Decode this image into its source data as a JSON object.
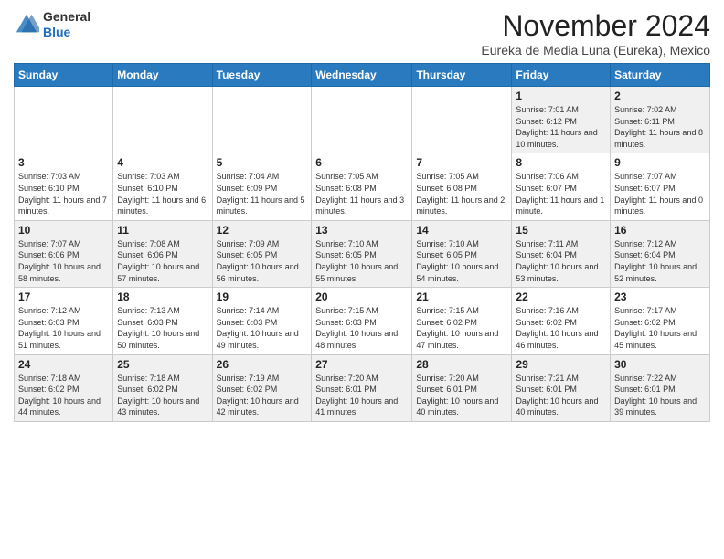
{
  "header": {
    "logo_line1": "General",
    "logo_line2": "Blue",
    "month": "November 2024",
    "location": "Eureka de Media Luna (Eureka), Mexico"
  },
  "days_of_week": [
    "Sunday",
    "Monday",
    "Tuesday",
    "Wednesday",
    "Thursday",
    "Friday",
    "Saturday"
  ],
  "weeks": [
    [
      {
        "day": "",
        "info": "",
        "empty": true
      },
      {
        "day": "",
        "info": "",
        "empty": true
      },
      {
        "day": "",
        "info": "",
        "empty": true
      },
      {
        "day": "",
        "info": "",
        "empty": true
      },
      {
        "day": "",
        "info": "",
        "empty": true
      },
      {
        "day": "1",
        "info": "Sunrise: 7:01 AM\nSunset: 6:12 PM\nDaylight: 11 hours and 10 minutes."
      },
      {
        "day": "2",
        "info": "Sunrise: 7:02 AM\nSunset: 6:11 PM\nDaylight: 11 hours and 8 minutes."
      }
    ],
    [
      {
        "day": "3",
        "info": "Sunrise: 7:03 AM\nSunset: 6:10 PM\nDaylight: 11 hours and 7 minutes."
      },
      {
        "day": "4",
        "info": "Sunrise: 7:03 AM\nSunset: 6:10 PM\nDaylight: 11 hours and 6 minutes."
      },
      {
        "day": "5",
        "info": "Sunrise: 7:04 AM\nSunset: 6:09 PM\nDaylight: 11 hours and 5 minutes."
      },
      {
        "day": "6",
        "info": "Sunrise: 7:05 AM\nSunset: 6:08 PM\nDaylight: 11 hours and 3 minutes."
      },
      {
        "day": "7",
        "info": "Sunrise: 7:05 AM\nSunset: 6:08 PM\nDaylight: 11 hours and 2 minutes."
      },
      {
        "day": "8",
        "info": "Sunrise: 7:06 AM\nSunset: 6:07 PM\nDaylight: 11 hours and 1 minute."
      },
      {
        "day": "9",
        "info": "Sunrise: 7:07 AM\nSunset: 6:07 PM\nDaylight: 11 hours and 0 minutes."
      }
    ],
    [
      {
        "day": "10",
        "info": "Sunrise: 7:07 AM\nSunset: 6:06 PM\nDaylight: 10 hours and 58 minutes."
      },
      {
        "day": "11",
        "info": "Sunrise: 7:08 AM\nSunset: 6:06 PM\nDaylight: 10 hours and 57 minutes."
      },
      {
        "day": "12",
        "info": "Sunrise: 7:09 AM\nSunset: 6:05 PM\nDaylight: 10 hours and 56 minutes."
      },
      {
        "day": "13",
        "info": "Sunrise: 7:10 AM\nSunset: 6:05 PM\nDaylight: 10 hours and 55 minutes."
      },
      {
        "day": "14",
        "info": "Sunrise: 7:10 AM\nSunset: 6:05 PM\nDaylight: 10 hours and 54 minutes."
      },
      {
        "day": "15",
        "info": "Sunrise: 7:11 AM\nSunset: 6:04 PM\nDaylight: 10 hours and 53 minutes."
      },
      {
        "day": "16",
        "info": "Sunrise: 7:12 AM\nSunset: 6:04 PM\nDaylight: 10 hours and 52 minutes."
      }
    ],
    [
      {
        "day": "17",
        "info": "Sunrise: 7:12 AM\nSunset: 6:03 PM\nDaylight: 10 hours and 51 minutes."
      },
      {
        "day": "18",
        "info": "Sunrise: 7:13 AM\nSunset: 6:03 PM\nDaylight: 10 hours and 50 minutes."
      },
      {
        "day": "19",
        "info": "Sunrise: 7:14 AM\nSunset: 6:03 PM\nDaylight: 10 hours and 49 minutes."
      },
      {
        "day": "20",
        "info": "Sunrise: 7:15 AM\nSunset: 6:03 PM\nDaylight: 10 hours and 48 minutes."
      },
      {
        "day": "21",
        "info": "Sunrise: 7:15 AM\nSunset: 6:02 PM\nDaylight: 10 hours and 47 minutes."
      },
      {
        "day": "22",
        "info": "Sunrise: 7:16 AM\nSunset: 6:02 PM\nDaylight: 10 hours and 46 minutes."
      },
      {
        "day": "23",
        "info": "Sunrise: 7:17 AM\nSunset: 6:02 PM\nDaylight: 10 hours and 45 minutes."
      }
    ],
    [
      {
        "day": "24",
        "info": "Sunrise: 7:18 AM\nSunset: 6:02 PM\nDaylight: 10 hours and 44 minutes."
      },
      {
        "day": "25",
        "info": "Sunrise: 7:18 AM\nSunset: 6:02 PM\nDaylight: 10 hours and 43 minutes."
      },
      {
        "day": "26",
        "info": "Sunrise: 7:19 AM\nSunset: 6:02 PM\nDaylight: 10 hours and 42 minutes."
      },
      {
        "day": "27",
        "info": "Sunrise: 7:20 AM\nSunset: 6:01 PM\nDaylight: 10 hours and 41 minutes."
      },
      {
        "day": "28",
        "info": "Sunrise: 7:20 AM\nSunset: 6:01 PM\nDaylight: 10 hours and 40 minutes."
      },
      {
        "day": "29",
        "info": "Sunrise: 7:21 AM\nSunset: 6:01 PM\nDaylight: 10 hours and 40 minutes."
      },
      {
        "day": "30",
        "info": "Sunrise: 7:22 AM\nSunset: 6:01 PM\nDaylight: 10 hours and 39 minutes."
      }
    ]
  ]
}
